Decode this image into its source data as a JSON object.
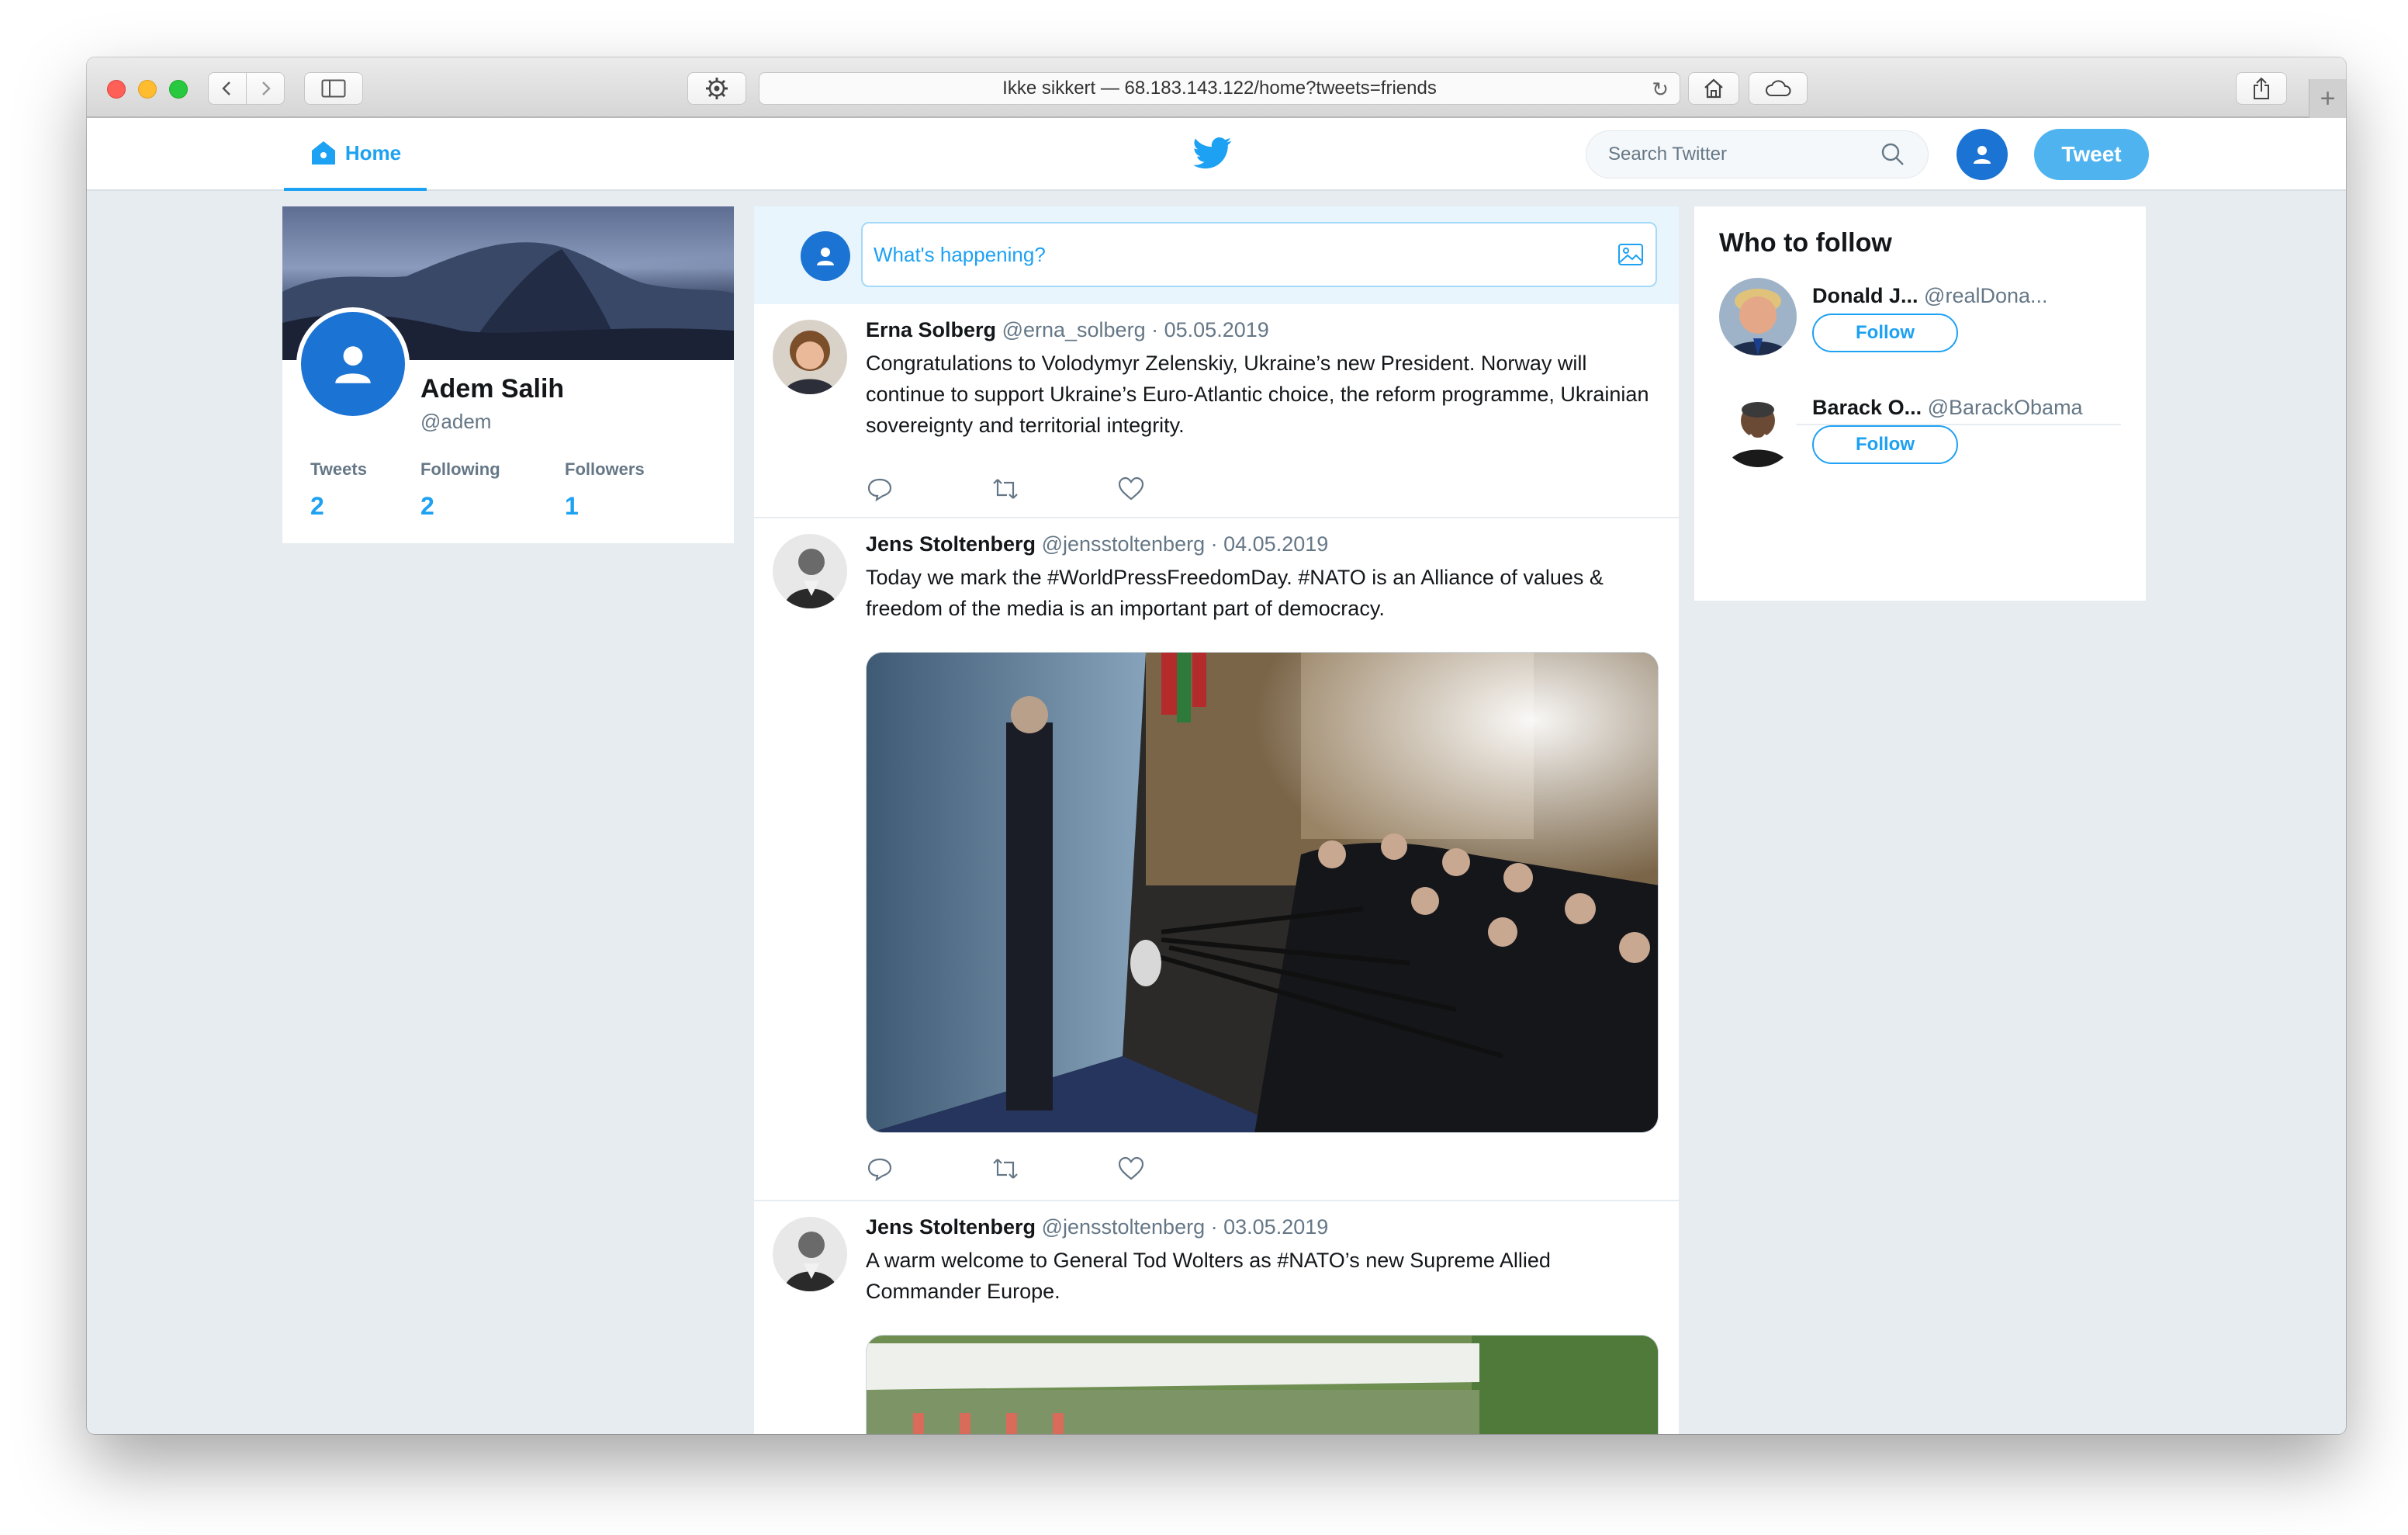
{
  "browser": {
    "address": "Ikke sikkert — 68.183.143.122/home?tweets=friends"
  },
  "header": {
    "home_label": "Home",
    "search_placeholder": "Search Twitter",
    "tweet_button": "Tweet",
    "accent": "#1da1f2"
  },
  "profile": {
    "name": "Adem Salih",
    "handle": "@adem",
    "stats": [
      {
        "label": "Tweets",
        "value": "2"
      },
      {
        "label": "Following",
        "value": "2"
      },
      {
        "label": "Followers",
        "value": "1"
      }
    ]
  },
  "composer": {
    "placeholder": "What's happening?"
  },
  "tweets": [
    {
      "author": "Erna Solberg",
      "handle": "@erna_solberg",
      "date": "05.05.2019",
      "text": "Congratulations to Volodymyr Zelenskiy, Ukraine’s new President. Norway will continue to support Ukraine’s Euro-Atlantic choice, the reform programme, Ukrainian sovereignty and territorial integrity."
    },
    {
      "author": "Jens Stoltenberg",
      "handle": "@jensstoltenberg",
      "date": "04.05.2019",
      "text": "Today we mark the #WorldPressFreedomDay. #NATO is an Alliance of values & freedom of the media is an important part of democracy."
    },
    {
      "author": "Jens Stoltenberg",
      "handle": "@jensstoltenberg",
      "date": "03.05.2019",
      "text": "A warm welcome to General Tod Wolters as #NATO’s new Supreme Allied Commander Europe."
    }
  ],
  "who_to_follow": {
    "title": "Who to follow",
    "items": [
      {
        "name": "Donald J...",
        "handle": "@realDona...",
        "button": "Follow"
      },
      {
        "name": "Barack O...",
        "handle": "@BarackObama",
        "button": "Follow"
      }
    ]
  },
  "separator": "·"
}
